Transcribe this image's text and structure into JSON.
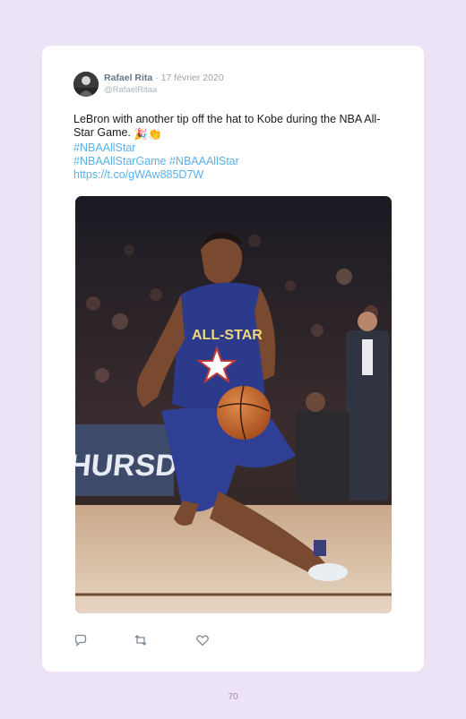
{
  "tweet": {
    "author_name": "Rafael Rita",
    "separator": " · ",
    "date": "17 février 2020",
    "handle": "@RafaelRitaa",
    "text": "LeBron with another tip off the hat to Kobe during the NBA All-Star Game.",
    "emojis": "🎉👏",
    "hashtag_1": "#NBAAllStar",
    "hashtags_2": "#NBAAllStarGame #NBAAAllStar",
    "link": "https://t.co/gWAw885D7W",
    "photo": {
      "jersey_text": "ALL-STAR",
      "banner_text": "THURSDAY"
    }
  },
  "actions": {
    "icons": [
      "reply-icon",
      "retweet-icon",
      "like-icon"
    ]
  },
  "page": {
    "number": "70"
  },
  "colors": {
    "background": "#ede3f7",
    "card": "#ffffff",
    "link": "#5ab0e8",
    "muted": "#9aa3ad"
  }
}
